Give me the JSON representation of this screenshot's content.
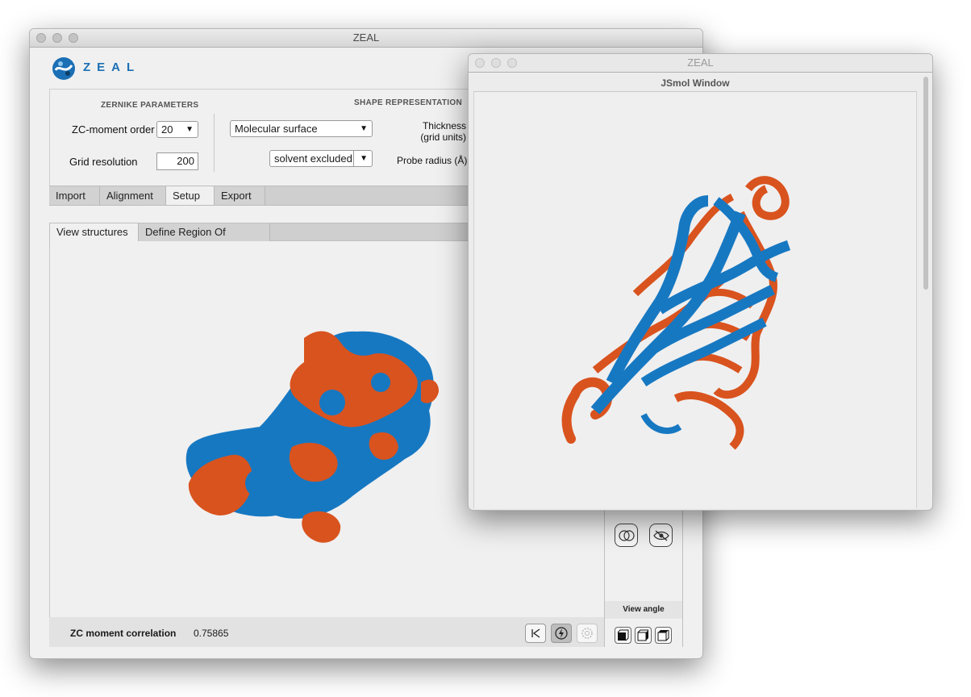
{
  "main_window": {
    "title": "ZEAL",
    "logo_text": "ZEAL",
    "zernike": {
      "header": "ZERNIKE PARAMETERS",
      "moment_order_label": "ZC-moment order",
      "moment_order_value": "20",
      "grid_resolution_label": "Grid resolution",
      "grid_resolution_value": "200"
    },
    "shape": {
      "header": "SHAPE REPRESENTATION",
      "surface_type": "Molecular surface",
      "surface_subtype": "solvent excluded",
      "thickness_label_1": "Thickness",
      "thickness_label_2": "(grid units)",
      "probe_radius_label": "Probe radius (Å)"
    },
    "tabs": [
      {
        "label": "Import"
      },
      {
        "label": "Alignment"
      },
      {
        "label": "Setup"
      },
      {
        "label": "Export"
      }
    ],
    "active_tab": "Setup",
    "sub_tabs": [
      {
        "label": "View structures"
      },
      {
        "label": "Define Region Of Interest"
      }
    ],
    "active_sub_tab": "View structures",
    "view_angle_label": "View angle",
    "footer": {
      "correlation_label": "ZC moment correlation",
      "correlation_value": "0.75865"
    }
  },
  "jsmol_window": {
    "title": "ZEAL",
    "header": "JSmol Window"
  },
  "colors": {
    "structure_a": "#1778c2",
    "structure_b": "#d9531e",
    "logo_blue": "#1a6fb5"
  }
}
